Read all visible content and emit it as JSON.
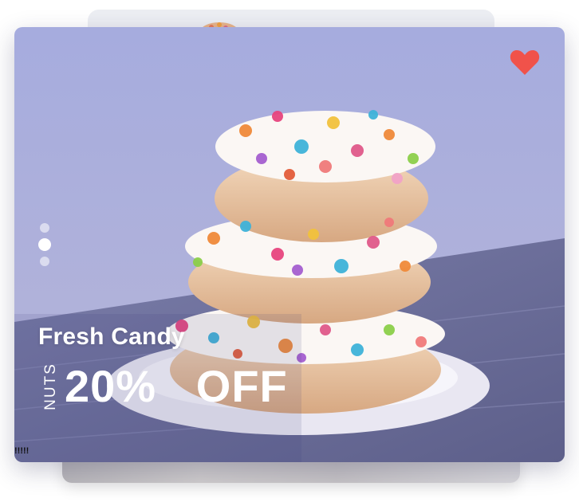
{
  "promo": {
    "title": "Fresh Candy",
    "vertical_label": "NUTS",
    "discount_text": "20%   OFF",
    "caption": "!!!!!"
  },
  "carousel": {
    "slide_count": 3,
    "active_index": 1
  },
  "favorite": {
    "icon": "heart-icon",
    "color": "#f0524a",
    "active": true
  },
  "colors": {
    "background_wall": "#a9aedc",
    "table": "#6e6f98",
    "text": "#ffffff"
  }
}
